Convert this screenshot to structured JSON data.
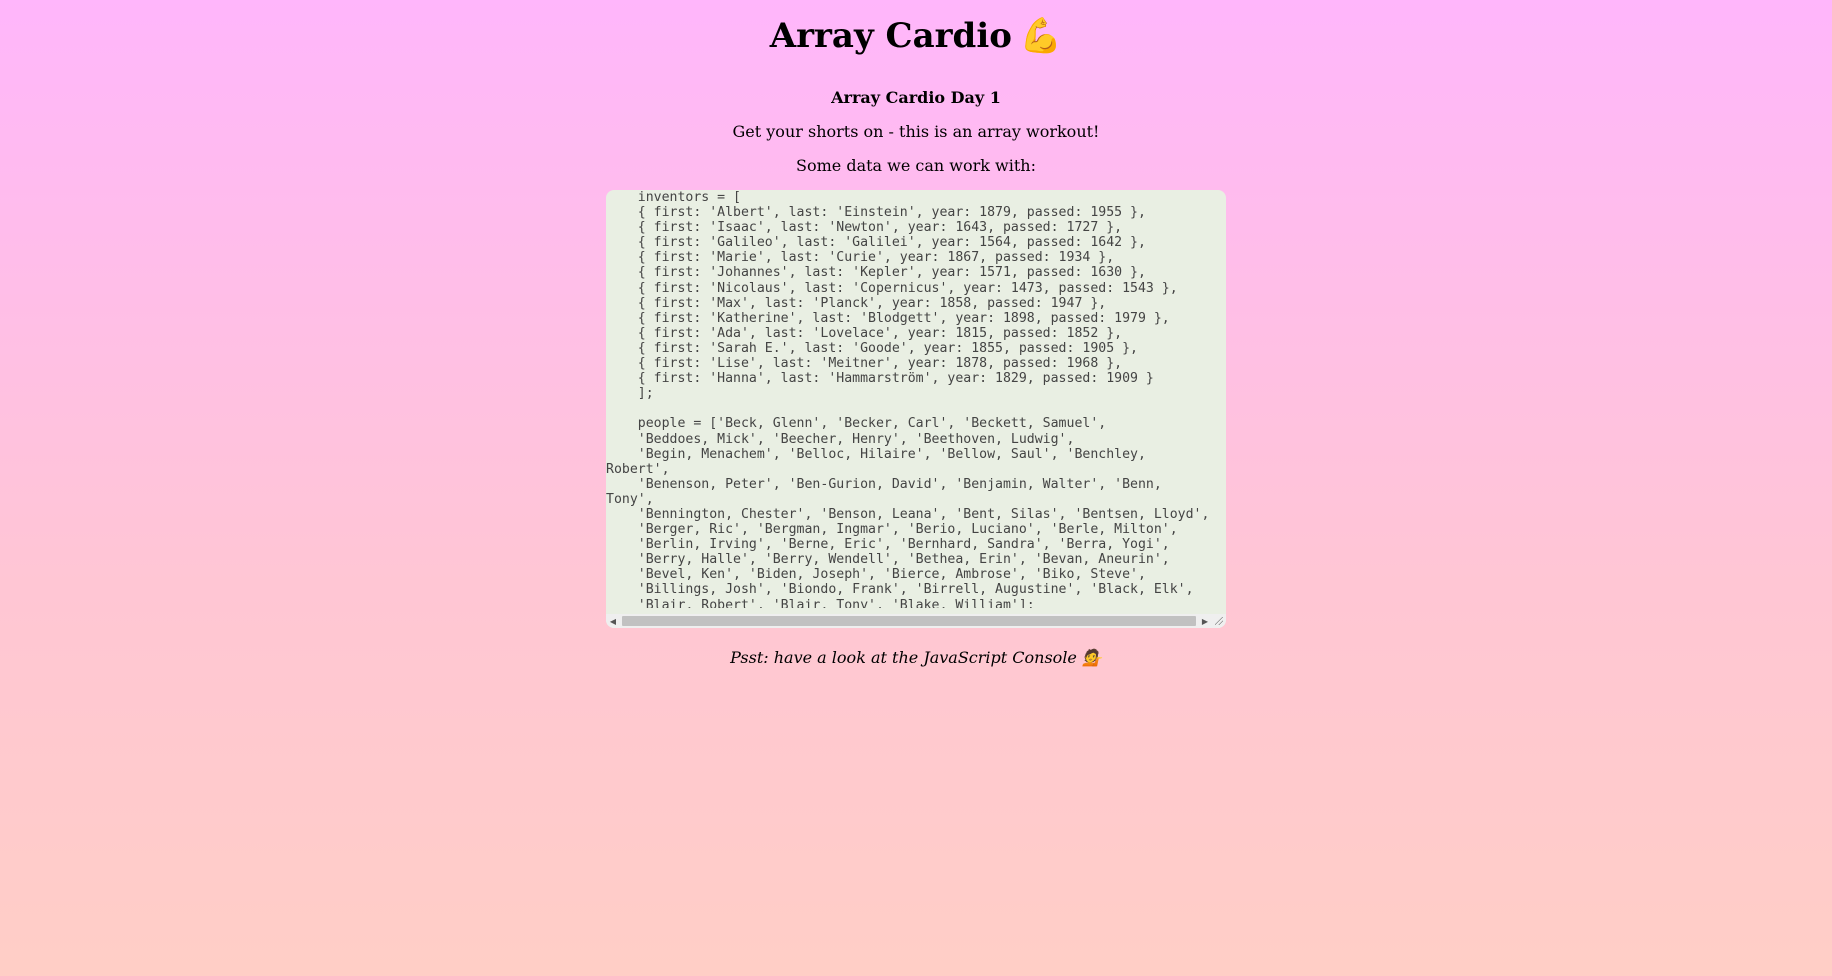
{
  "title": "Array Cardio",
  "title_emoji": "💪",
  "subtitle": "Array Cardio Day 1",
  "intro": "Get your shorts on - this is an array workout!",
  "data_intro": "Some data we can work with:",
  "code": "    inventors = [\n    { first: 'Albert', last: 'Einstein', year: 1879, passed: 1955 },\n    { first: 'Isaac', last: 'Newton', year: 1643, passed: 1727 },\n    { first: 'Galileo', last: 'Galilei', year: 1564, passed: 1642 },\n    { first: 'Marie', last: 'Curie', year: 1867, passed: 1934 },\n    { first: 'Johannes', last: 'Kepler', year: 1571, passed: 1630 },\n    { first: 'Nicolaus', last: 'Copernicus', year: 1473, passed: 1543 },\n    { first: 'Max', last: 'Planck', year: 1858, passed: 1947 },\n    { first: 'Katherine', last: 'Blodgett', year: 1898, passed: 1979 },\n    { first: 'Ada', last: 'Lovelace', year: 1815, passed: 1852 },\n    { first: 'Sarah E.', last: 'Goode', year: 1855, passed: 1905 },\n    { first: 'Lise', last: 'Meitner', year: 1878, passed: 1968 },\n    { first: 'Hanna', last: 'Hammarström', year: 1829, passed: 1909 }\n    ];\n\n    people = ['Beck, Glenn', 'Becker, Carl', 'Beckett, Samuel',\n    'Beddoes, Mick', 'Beecher, Henry', 'Beethoven, Ludwig',\n    'Begin, Menachem', 'Belloc, Hilaire', 'Bellow, Saul', 'Benchley,\nRobert',\n    'Benenson, Peter', 'Ben-Gurion, David', 'Benjamin, Walter', 'Benn,\nTony',\n    'Bennington, Chester', 'Benson, Leana', 'Bent, Silas', 'Bentsen, Lloyd',\n    'Berger, Ric', 'Bergman, Ingmar', 'Berio, Luciano', 'Berle, Milton',\n    'Berlin, Irving', 'Berne, Eric', 'Bernhard, Sandra', 'Berra, Yogi',\n    'Berry, Halle', 'Berry, Wendell', 'Bethea, Erin', 'Bevan, Aneurin',\n    'Bevel, Ken', 'Biden, Joseph', 'Bierce, Ambrose', 'Biko, Steve',\n    'Billings, Josh', 'Biondo, Frank', 'Birrell, Augustine', 'Black, Elk',\n    'Blair, Robert', 'Blair, Tony', 'Blake, William'];",
  "psst": "Psst: have a look at the JavaScript Console",
  "psst_emoji": "💁"
}
